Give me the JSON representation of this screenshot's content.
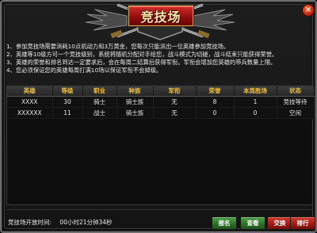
{
  "window": {
    "title": "竞技场",
    "close_glyph": "×"
  },
  "rules": [
    "1、参加竞技场需要消耗10点机动力和3万黄金，您每次只能派出一位英雄参加竞技场。",
    "2、英雄等10级方可一个竞技级别，系统将随机分配对手给您，战斗模式为切磋，战斗结束只能获得荣誉。",
    "3、英雄的荣誉和排名到达一定要求后，会在每周二结算后获得军衔。军衔会增加您英雄的带兵数量上限。",
    "4、您必须保证您的英雄每周打满10场以保证军衔不会掉级。"
  ],
  "table": {
    "headers": [
      "英雄",
      "等级",
      "职业",
      "种族",
      "军衔",
      "荣誉",
      "本周胜场",
      "状态"
    ],
    "rows": [
      [
        "XXXX",
        "30",
        "骑士",
        "骑士族",
        "无",
        "8",
        "1",
        "竞技等待"
      ],
      [
        "XXXXXX",
        "11",
        "战士",
        "骑士族",
        "无",
        "0",
        "0",
        "空闲"
      ]
    ]
  },
  "footer": {
    "timer_label": "竞技场开放时间:",
    "timer_value": "00小时21分钟34秒"
  },
  "buttons": {
    "signup": "报名",
    "view": "查看",
    "exchange": "交换",
    "ranking": "排行"
  },
  "colors": {
    "header_text": "#f0c040",
    "banner": "#b81414",
    "green_button": "#2d6e28",
    "red_button": "#9c1b12"
  }
}
